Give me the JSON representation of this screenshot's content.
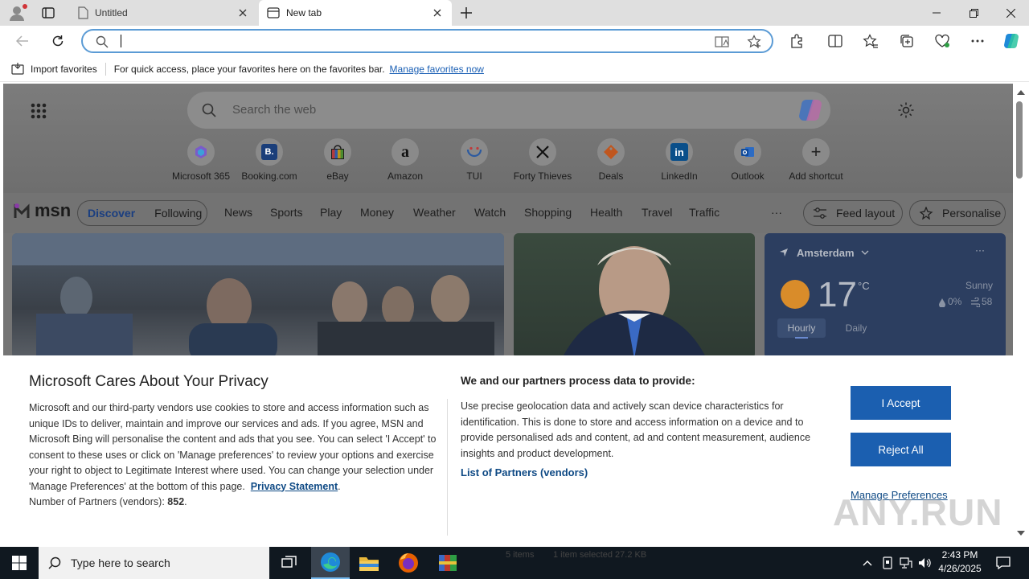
{
  "tabs": [
    {
      "title": "Untitled"
    },
    {
      "title": "New tab"
    }
  ],
  "address_bar": {
    "value": "",
    "placeholder": ""
  },
  "favorites_bar": {
    "import_label": "Import favorites",
    "message": "For quick access, place your favorites here on the favorites bar.",
    "manage_link": "Manage favorites now"
  },
  "newtab": {
    "search_placeholder": "Search the web",
    "shortcuts": [
      {
        "label": "Microsoft 365",
        "glyph": ""
      },
      {
        "label": "Booking.com",
        "glyph": "B."
      },
      {
        "label": "eBay",
        "glyph": ""
      },
      {
        "label": "Amazon",
        "glyph": "a"
      },
      {
        "label": "TUI",
        "glyph": ""
      },
      {
        "label": "Forty Thieves",
        "glyph": ""
      },
      {
        "label": "Deals",
        "glyph": ""
      },
      {
        "label": "LinkedIn",
        "glyph": "in"
      },
      {
        "label": "Outlook",
        "glyph": ""
      },
      {
        "label": "Add shortcut",
        "glyph": "+"
      }
    ],
    "msn": {
      "logo": "msn",
      "tabs": [
        "Discover",
        "Following"
      ],
      "nav": [
        "News",
        "Sports",
        "Play",
        "Money",
        "Weather",
        "Watch",
        "Shopping",
        "Health",
        "Travel",
        "Traffic"
      ],
      "more": "···",
      "feed_layout": "Feed layout",
      "personalise": "Personalise"
    },
    "weather": {
      "location": "Amsterdam",
      "temp": "17",
      "unit": "°C",
      "condition": "Sunny",
      "precip": "0%",
      "aqi": "58",
      "tab_hourly": "Hourly",
      "tab_daily": "Daily"
    }
  },
  "privacy": {
    "title": "Microsoft Cares About Your Privacy",
    "body": "Microsoft and our third-party vendors use cookies to store and access information such as unique IDs to deliver, maintain and improve our services and ads. If you agree, MSN and Microsoft Bing will personalise the content and ads that you see. You can select 'I Accept' to consent to these uses or click on 'Manage preferences' to review your options and exercise your right to object to Legitimate Interest where used. You can change your selection under 'Manage Preferences' at the bottom of this page.",
    "privacy_link": "Privacy Statement",
    "partners_label": "Number of Partners (vendors):",
    "partners_count": "852",
    "right_title": "We and our partners process data to provide:",
    "right_body": "Use precise geolocation data and actively scan device characteristics for identification. This is done to store and access information on a device and to provide personalised ads and content, ad and content measurement, audience insights and product development.",
    "partners_link": "List of Partners (vendors)",
    "accept": "I Accept",
    "reject": "Reject All",
    "manage": "Manage Preferences"
  },
  "explorer_status": {
    "items": "5 items",
    "selected": "1 item selected  27.2 KB"
  },
  "taskbar": {
    "search_placeholder": "Type here to search",
    "time": "2:43 PM",
    "date": "4/26/2025"
  },
  "watermark": "ANY.RUN",
  "colors": {
    "accent": "#1b5fb0",
    "link": "#0f4a85",
    "taskbar": "#101820"
  }
}
